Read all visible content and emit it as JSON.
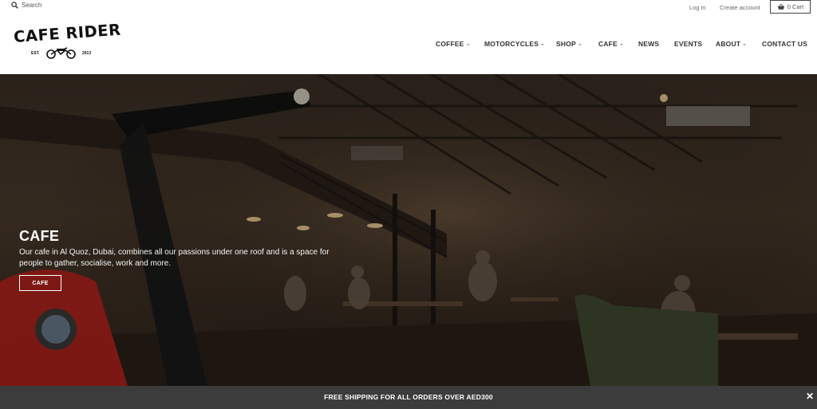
{
  "topbar": {
    "search_placeholder": "Search",
    "login_label": "Log in",
    "create_account_label": "Create account",
    "cart_label": "0 Cart"
  },
  "logo": {
    "name": "CAFE RIDER",
    "est": "EST.",
    "year": "2013"
  },
  "nav": {
    "items": [
      {
        "label": "COFFEE",
        "dropdown": true
      },
      {
        "label": "MOTORCYCLES",
        "dropdown": true
      },
      {
        "label": "SHOP",
        "dropdown": true
      },
      {
        "label": "CAFE",
        "dropdown": true
      },
      {
        "label": "NEWS",
        "dropdown": false
      },
      {
        "label": "EVENTS",
        "dropdown": false
      },
      {
        "label": "ABOUT",
        "dropdown": true
      },
      {
        "label": "CONTACT US",
        "dropdown": false
      }
    ]
  },
  "hero": {
    "title": "CAFE",
    "description": "Our cafe in Al Quoz, Dubai, combines all our passions under one roof and is a space for people to gather, socialise, work and more.",
    "button_label": "CAFE"
  },
  "announcement": {
    "text": "FREE SHIPPING FOR ALL ORDERS OVER AED300",
    "close_symbol": "✕"
  },
  "colors": {
    "announcement_bg": "#3c3c3c",
    "nav_text": "#333333",
    "hero_overlay": "#2a1f17"
  }
}
